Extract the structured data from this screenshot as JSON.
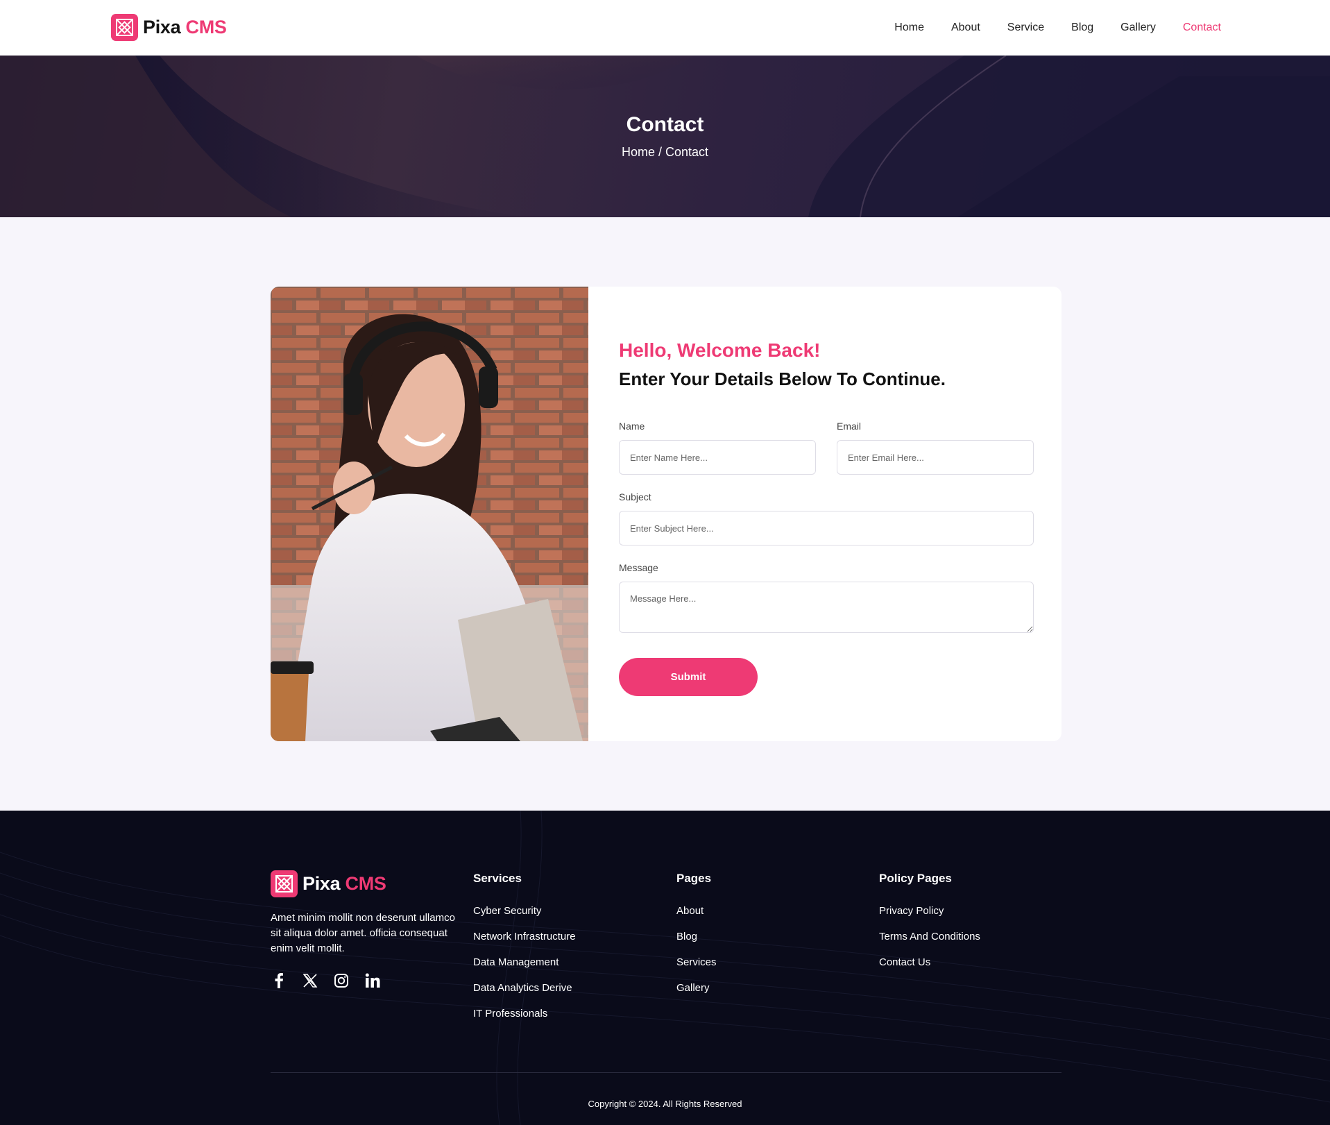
{
  "brand": {
    "name_a": "Pixa",
    "name_b": "CMS",
    "accent": "#ee3a74"
  },
  "nav": {
    "items": [
      {
        "label": "Home"
      },
      {
        "label": "About"
      },
      {
        "label": "Service"
      },
      {
        "label": "Blog"
      },
      {
        "label": "Gallery"
      },
      {
        "label": "Contact",
        "active": true
      }
    ]
  },
  "hero": {
    "title": "Contact",
    "breadcrumb": "Home / Contact"
  },
  "form": {
    "greeting": "Hello, Welcome Back!",
    "subtitle": "Enter Your Details Below To Continue.",
    "name_label": "Name",
    "name_placeholder": "Enter Name Here...",
    "email_label": "Email",
    "email_placeholder": "Enter Email Here...",
    "subject_label": "Subject",
    "subject_placeholder": "Enter Subject Here...",
    "message_label": "Message",
    "message_placeholder": "Message Here...",
    "submit_label": "Submit"
  },
  "footer": {
    "about": "Amet minim mollit non deserunt ullamco sit aliqua dolor amet. officia consequat enim velit mollit.",
    "socials": [
      "facebook-icon",
      "x-icon",
      "instagram-icon",
      "linkedin-icon"
    ],
    "services": {
      "title": "Services",
      "links": [
        "Cyber Security",
        "Network Infrastructure",
        "Data Management",
        "Data Analytics Derive",
        "IT Professionals"
      ]
    },
    "pages": {
      "title": "Pages",
      "links": [
        "About",
        "Blog",
        "Services",
        "Gallery"
      ]
    },
    "policy": {
      "title": "Policy Pages",
      "links": [
        "Privacy Policy",
        "Terms And Conditions",
        "Contact Us"
      ]
    },
    "copyright": "Copyright © 2024. All Rights Reserved"
  }
}
